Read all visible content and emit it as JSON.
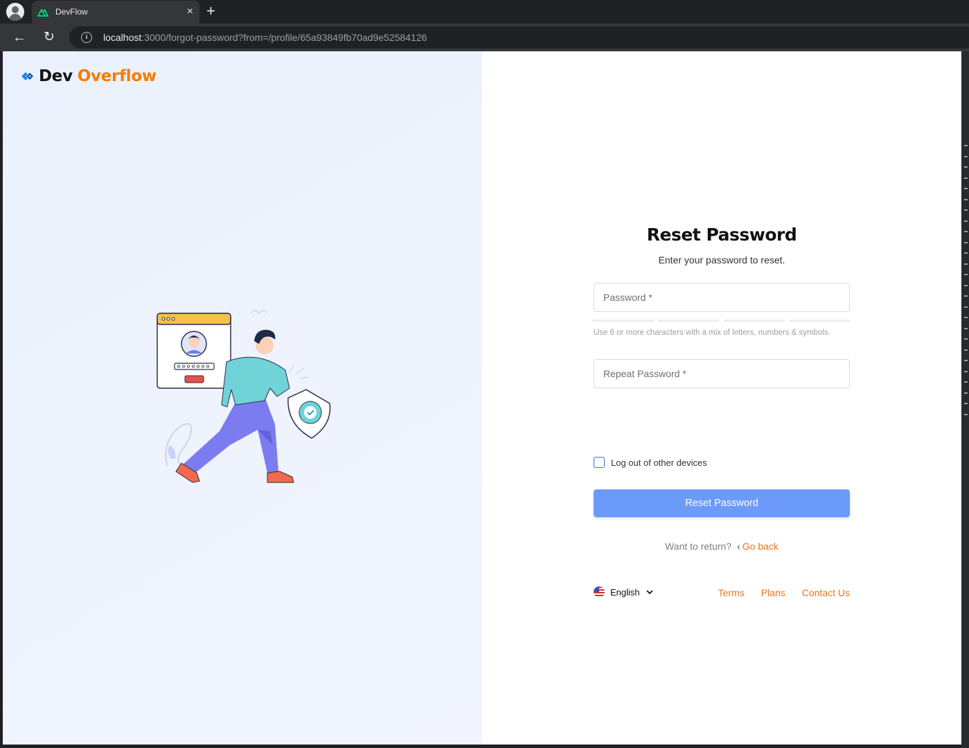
{
  "browser": {
    "tab_title": "DevFlow",
    "close_glyph": "×",
    "newtab_glyph": "+",
    "back_glyph": "←",
    "reload_glyph": "↻",
    "url_host": "localhost",
    "url_rest": ":3000/forgot-password?from=/profile/65a93849fb70ad9e52584126",
    "info_glyph": "i"
  },
  "brand": {
    "name_primary": "Dev",
    "name_accent": "Overflow",
    "accent_color": "#f57c00",
    "logo_color": "#1e88e5"
  },
  "form": {
    "title": "Reset Password",
    "subtitle": "Enter your password to reset.",
    "password_placeholder": "Password *",
    "strength_hint": "Use 6 or more characters with a mix of letters, numbers & symbols.",
    "repeat_placeholder": "Repeat Password *",
    "logout_label": "Log out of other devices",
    "logout_checked": false,
    "submit_label": "Reset Password",
    "submit_color": "#6c9af9",
    "return_text": "Want to return?",
    "return_chevron": "‹",
    "return_link": "Go back"
  },
  "footer": {
    "language": "English",
    "links": [
      "Terms",
      "Plans",
      "Contact Us"
    ],
    "link_color": "#e8761e"
  }
}
